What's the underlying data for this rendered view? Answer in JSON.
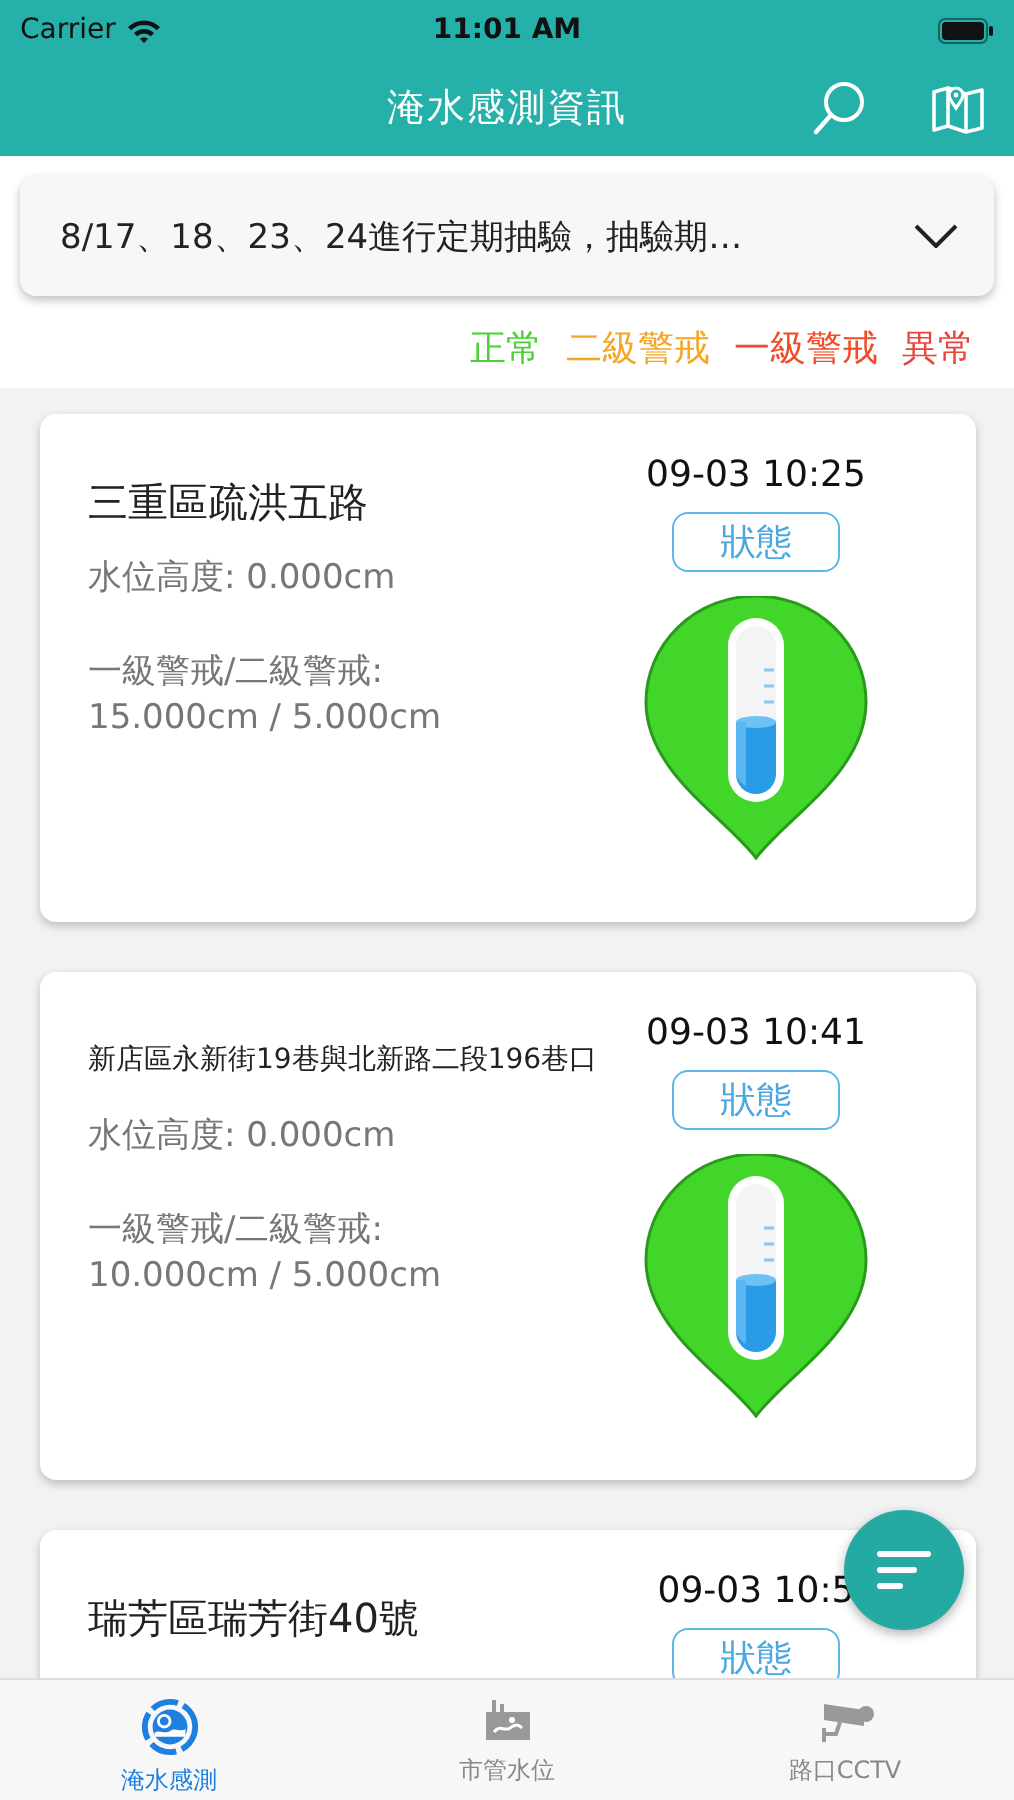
{
  "status_bar": {
    "carrier": "Carrier",
    "time": "11:01 AM"
  },
  "nav_bar": {
    "title": "淹水感測資訊"
  },
  "notice": {
    "text": "8/17、18、23、24進行定期抽驗，抽驗期…",
    "expanded": false
  },
  "legend": [
    {
      "label": "正常",
      "color": "#4cd137"
    },
    {
      "label": "二級警戒",
      "color": "#f5a623"
    },
    {
      "label": "一級警戒",
      "color": "#f24b2a"
    },
    {
      "label": "異常",
      "color": "#e8453c"
    }
  ],
  "sensors": [
    {
      "name": "三重區疏洪五路",
      "time": "09-03 10:25",
      "status_button": "狀態",
      "water_level": "水位高度: 0.000cm",
      "thresholds_label": "一級警戒/二級警戒:",
      "thresholds": "15.000cm / 5.000cm",
      "color": "#42d62a"
    },
    {
      "name": "新店區永新街19巷與北新路二段196巷口",
      "time": "09-03 10:41",
      "status_button": "狀態",
      "water_level": "水位高度: 0.000cm",
      "thresholds_label": "一級警戒/二級警戒:",
      "thresholds": "10.000cm / 5.000cm",
      "color": "#42d62a"
    },
    {
      "name": "瑞芳區瑞芳街40號",
      "time": "09-03 10:5",
      "status_button": "狀態"
    }
  ],
  "tabs": [
    {
      "label": "淹水感測",
      "selected": true
    },
    {
      "label": "市管水位",
      "selected": false
    },
    {
      "label": "路口CCTV",
      "selected": false
    }
  ]
}
